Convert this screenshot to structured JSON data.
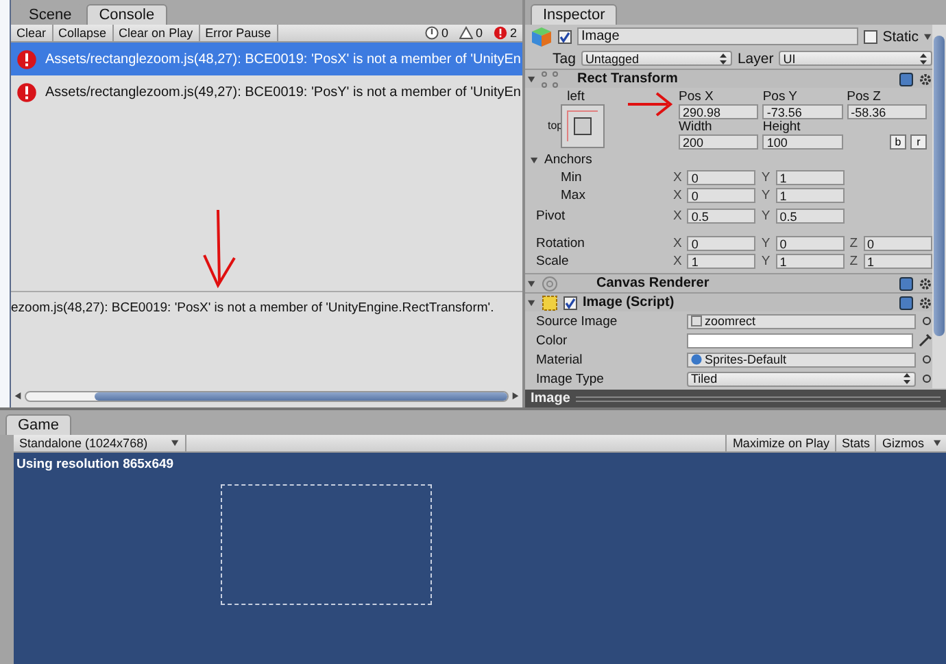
{
  "console": {
    "tabs": [
      {
        "label": "Scene",
        "selected": false
      },
      {
        "label": "Console",
        "selected": true
      }
    ],
    "toolbar": [
      "Clear",
      "Collapse",
      "Clear on Play",
      "Error Pause"
    ],
    "counters": [
      {
        "kind": "info",
        "count": "0"
      },
      {
        "kind": "warning",
        "count": "0"
      },
      {
        "kind": "error",
        "count": "2"
      }
    ],
    "messages": [
      {
        "text": "Assets/rectanglezoom.js(48,27): BCE0019: 'PosX' is not a member of 'UnityEn",
        "selected": true
      },
      {
        "text": "Assets/rectanglezoom.js(49,27): BCE0019: 'PosY' is not a member of 'UnityEn",
        "selected": false
      }
    ],
    "detail": "ezoom.js(48,27): BCE0019: 'PosX' is not a member of 'UnityEngine.RectTransform'."
  },
  "inspector": {
    "title": "Inspector",
    "object": {
      "name": "Image",
      "active": true,
      "static_label": "Static",
      "static": false,
      "tag_label": "Tag",
      "tag": "Untagged",
      "layer_label": "Layer",
      "layer": "UI"
    },
    "rect_transform": {
      "title": "Rect Transform",
      "anchor_horizontal": "left",
      "anchor_vertical": "top",
      "position": [
        {
          "label": "Pos X",
          "value": "290.98"
        },
        {
          "label": "Pos Y",
          "value": "-73.56"
        },
        {
          "label": "Pos Z",
          "value": "-58.36"
        }
      ],
      "size": [
        {
          "label": "Width",
          "value": "200"
        },
        {
          "label": "Height",
          "value": "100"
        }
      ],
      "mode_buttons": [
        "b",
        "r"
      ],
      "anchors": {
        "label": "Anchors",
        "expanded": true,
        "children": [
          {
            "label": "Min",
            "values": [
              {
                "axis": "X",
                "value": "0"
              },
              {
                "axis": "Y",
                "value": "1"
              }
            ]
          },
          {
            "label": "Max",
            "values": [
              {
                "axis": "X",
                "value": "0"
              },
              {
                "axis": "Y",
                "value": "1"
              }
            ]
          }
        ]
      },
      "vectors": [
        {
          "label": "Pivot",
          "values": [
            {
              "axis": "X",
              "value": "0.5"
            },
            {
              "axis": "Y",
              "value": "0.5"
            }
          ]
        },
        {
          "label": "Rotation",
          "values": [
            {
              "axis": "X",
              "value": "0"
            },
            {
              "axis": "Y",
              "value": "0"
            },
            {
              "axis": "Z",
              "value": "0"
            }
          ]
        },
        {
          "label": "Scale",
          "values": [
            {
              "axis": "X",
              "value": "1"
            },
            {
              "axis": "Y",
              "value": "1"
            },
            {
              "axis": "Z",
              "value": "1"
            }
          ]
        }
      ]
    },
    "components": [
      {
        "title": "Canvas Renderer",
        "kind": "renderer"
      },
      {
        "title": "Image (Script)",
        "kind": "script",
        "enabled": true,
        "properties": [
          {
            "kind": "object",
            "label": "Source Image",
            "value": "zoomrect"
          },
          {
            "kind": "color",
            "label": "Color"
          },
          {
            "kind": "material",
            "label": "Material",
            "value": "Sprites-Default"
          },
          {
            "kind": "dropdown",
            "label": "Image Type",
            "value": "Tiled"
          }
        ]
      }
    ],
    "footer": "Image"
  },
  "game": {
    "tab": "Game",
    "resolution": "Standalone (1024x768)",
    "buttons": [
      "Maximize on Play",
      "Stats",
      "Gizmos"
    ],
    "overlay": "Using resolution 865x649"
  }
}
